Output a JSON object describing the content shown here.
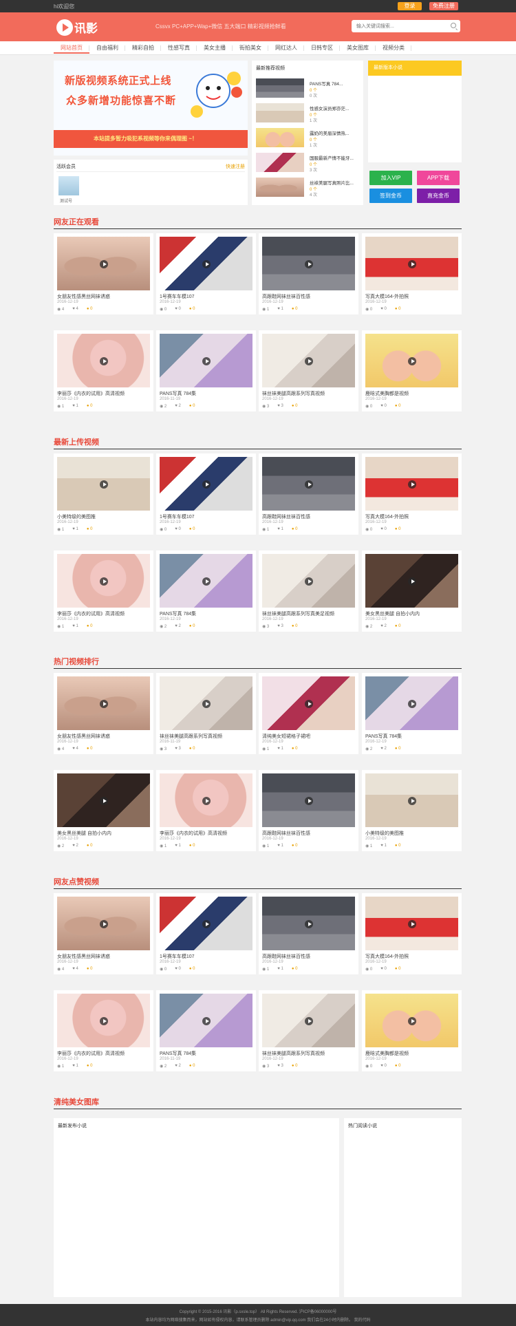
{
  "topbar": {
    "welcome": "hi欢迎您",
    "login": "登录",
    "register": "免费注册"
  },
  "header": {
    "logo": "讯影",
    "slogan": "Cssvx PC+APP+Wap+微信 五大端口 精彩视频抢鲜看",
    "search_placeholder": "输入关键词搜索..."
  },
  "nav": [
    "网站首页",
    "自由福利",
    "精彩自拍",
    "性感写真",
    "美女主播",
    "街拍美女",
    "网红达人",
    "日韩专区",
    "美女图库",
    "视频分类"
  ],
  "banner": {
    "line1": "新版视频系统正式上线",
    "line2": "众多新增功能惊喜不断",
    "foot": "本站提多暂力吸犯系视频等你来偶理图 ~！"
  },
  "members": {
    "title": "活跃会员",
    "link": "快速注册",
    "member_name": "测试号"
  },
  "recent": {
    "title": "最新推荐视频",
    "items": [
      {
        "title": "PANS写真 784...",
        "coins": "0 个",
        "views": "0 次"
      },
      {
        "title": "性感女演员郑亦茫...",
        "coins": "0 个",
        "views": "1 次"
      },
      {
        "title": "露奶的美眉深情热...",
        "coins": "0 个",
        "views": "1 次"
      },
      {
        "title": "国服最新产情不能牙...",
        "coins": "0 个",
        "views": "3 次"
      },
      {
        "title": "丝袜美腿写真照片比...",
        "coins": "0 个",
        "views": "4 次"
      }
    ]
  },
  "notice": {
    "title": "最新版本小说"
  },
  "actions": {
    "vip": "加入VIP",
    "app": "APP下载",
    "sign": "签到金币",
    "recharge": "直充金币"
  },
  "sections": [
    {
      "title": "网友正在观看",
      "rows": [
        [
          {
            "title": "女朋友性感黑丝网袜诱惑",
            "date": "2016-12-19",
            "views": "4",
            "likes": "4",
            "coins": "0",
            "img": "a"
          },
          {
            "title": "1号赛车车模107",
            "date": "2016-12-19",
            "views": "0",
            "likes": "0",
            "coins": "0",
            "img": "b"
          },
          {
            "title": "高跟鞋网袜丝袜百性感",
            "date": "2016-12-19",
            "views": "1",
            "likes": "1",
            "coins": "0",
            "img": "c"
          },
          {
            "title": "写真大模164-外拍照",
            "date": "2016-12-19",
            "views": "0",
            "likes": "0",
            "coins": "0",
            "img": "d"
          }
        ],
        [
          {
            "title": "李丽莎《内衣的试用》高清视频",
            "date": "2016-12-19",
            "views": "1",
            "likes": "1",
            "coins": "0",
            "img": "e"
          },
          {
            "title": "PANS写真 784集",
            "date": "2016-11-19",
            "views": "2",
            "likes": "2",
            "coins": "0",
            "img": "f"
          },
          {
            "title": "袜丝袜美腿高跟系列写真视频",
            "date": "2016-12-19",
            "views": "3",
            "likes": "3",
            "coins": "0",
            "img": "g"
          },
          {
            "title": "鹿晗式美胸都是视频",
            "date": "2016-12-19",
            "views": "0",
            "likes": "0",
            "coins": "0",
            "img": "h"
          }
        ]
      ]
    },
    {
      "title": "最新上传视频",
      "rows": [
        [
          {
            "title": "小美特级的美图推",
            "date": "2016-12-19",
            "views": "1",
            "likes": "1",
            "coins": "0",
            "img": "i"
          },
          {
            "title": "1号赛车车模107",
            "date": "2016-12-19",
            "views": "0",
            "likes": "0",
            "coins": "0",
            "img": "b"
          },
          {
            "title": "高跟鞋网袜丝袜百性感",
            "date": "2016-12-19",
            "views": "1",
            "likes": "1",
            "coins": "0",
            "img": "c"
          },
          {
            "title": "写真大模164-外拍照",
            "date": "2016-12-19",
            "views": "0",
            "likes": "0",
            "coins": "0",
            "img": "d"
          }
        ],
        [
          {
            "title": "李丽莎《内衣的试用》高清视频",
            "date": "2016-12-19",
            "views": "1",
            "likes": "1",
            "coins": "0",
            "img": "e"
          },
          {
            "title": "PANS写真 784集",
            "date": "2016-12-19",
            "views": "2",
            "likes": "2",
            "coins": "0",
            "img": "f"
          },
          {
            "title": "袜丝袜美腿高跟系列写真美足视频",
            "date": "2016-12-19",
            "views": "3",
            "likes": "3",
            "coins": "0",
            "img": "g"
          },
          {
            "title": "美女黑丝美腿 自拍小内内",
            "date": "2016-12-19",
            "views": "2",
            "likes": "2",
            "coins": "0",
            "img": "j"
          }
        ]
      ]
    },
    {
      "title": "热门视频排行",
      "rows": [
        [
          {
            "title": "女朋友性感黑丝网袜诱惑",
            "date": "2016-12-19",
            "views": "4",
            "likes": "4",
            "coins": "0",
            "img": "a"
          },
          {
            "title": "袜丝袜美腿高跟系列写真视频",
            "date": "2016-11-19",
            "views": "3",
            "likes": "3",
            "coins": "0",
            "img": "g"
          },
          {
            "title": "清纯美女短裙格子裙吧",
            "date": "2016-12-19",
            "views": "1",
            "likes": "1",
            "coins": "0",
            "img": "k"
          },
          {
            "title": "PANS写真 784集",
            "date": "2016-12-19",
            "views": "2",
            "likes": "2",
            "coins": "0",
            "img": "f"
          }
        ],
        [
          {
            "title": "美女黑丝美腿 自拍小内内",
            "date": "2016-12-19",
            "views": "2",
            "likes": "2",
            "coins": "0",
            "img": "j"
          },
          {
            "title": "李丽莎《内衣的试用》高清视频",
            "date": "2016-12-19",
            "views": "1",
            "likes": "1",
            "coins": "0",
            "img": "e"
          },
          {
            "title": "高跟鞋网袜丝袜百性感",
            "date": "2016-12-19",
            "views": "1",
            "likes": "1",
            "coins": "0",
            "img": "c"
          },
          {
            "title": "小美特级的美图推",
            "date": "2016-12-19",
            "views": "1",
            "likes": "1",
            "coins": "0",
            "img": "i"
          }
        ]
      ]
    },
    {
      "title": "网友点赞视频",
      "rows": [
        [
          {
            "title": "女朋友性感黑丝网袜诱惑",
            "date": "2016-12-19",
            "views": "4",
            "likes": "4",
            "coins": "0",
            "img": "a"
          },
          {
            "title": "1号赛车车模107",
            "date": "2016-12-19",
            "views": "0",
            "likes": "0",
            "coins": "0",
            "img": "b"
          },
          {
            "title": "高跟鞋网袜丝袜百性感",
            "date": "2016-12-19",
            "views": "1",
            "likes": "1",
            "coins": "0",
            "img": "c"
          },
          {
            "title": "写真大模164-外拍照",
            "date": "2016-12-19",
            "views": "0",
            "likes": "0",
            "coins": "0",
            "img": "d"
          }
        ],
        [
          {
            "title": "李丽莎《内衣的试用》高清视频",
            "date": "2016-12-19",
            "views": "1",
            "likes": "1",
            "coins": "0",
            "img": "e"
          },
          {
            "title": "PANS写真 784集",
            "date": "2016-11-19",
            "views": "2",
            "likes": "2",
            "coins": "0",
            "img": "f"
          },
          {
            "title": "袜丝袜美腿高跟系列写真视频",
            "date": "2016-12-19",
            "views": "3",
            "likes": "3",
            "coins": "0",
            "img": "g"
          },
          {
            "title": "鹿晗式美胸都是视频",
            "date": "2016-12-19",
            "views": "0",
            "likes": "0",
            "coins": "0",
            "img": "h"
          }
        ]
      ]
    }
  ],
  "gallery": {
    "title": "清纯美女图库",
    "latest": "最新发布小说",
    "hot": "热门阅读小说"
  },
  "footer": {
    "line1": "Copyright © 2015-2016 讯影（p.sxsle.top） All Rights Reserved. 沪ICP备06000000号",
    "line2": "本站内容均为网络搜集而来，网站如有侵权内容，请联系管理员删除 admin@vip.qq.com 我们会在24小时内删除。  我的代码"
  }
}
